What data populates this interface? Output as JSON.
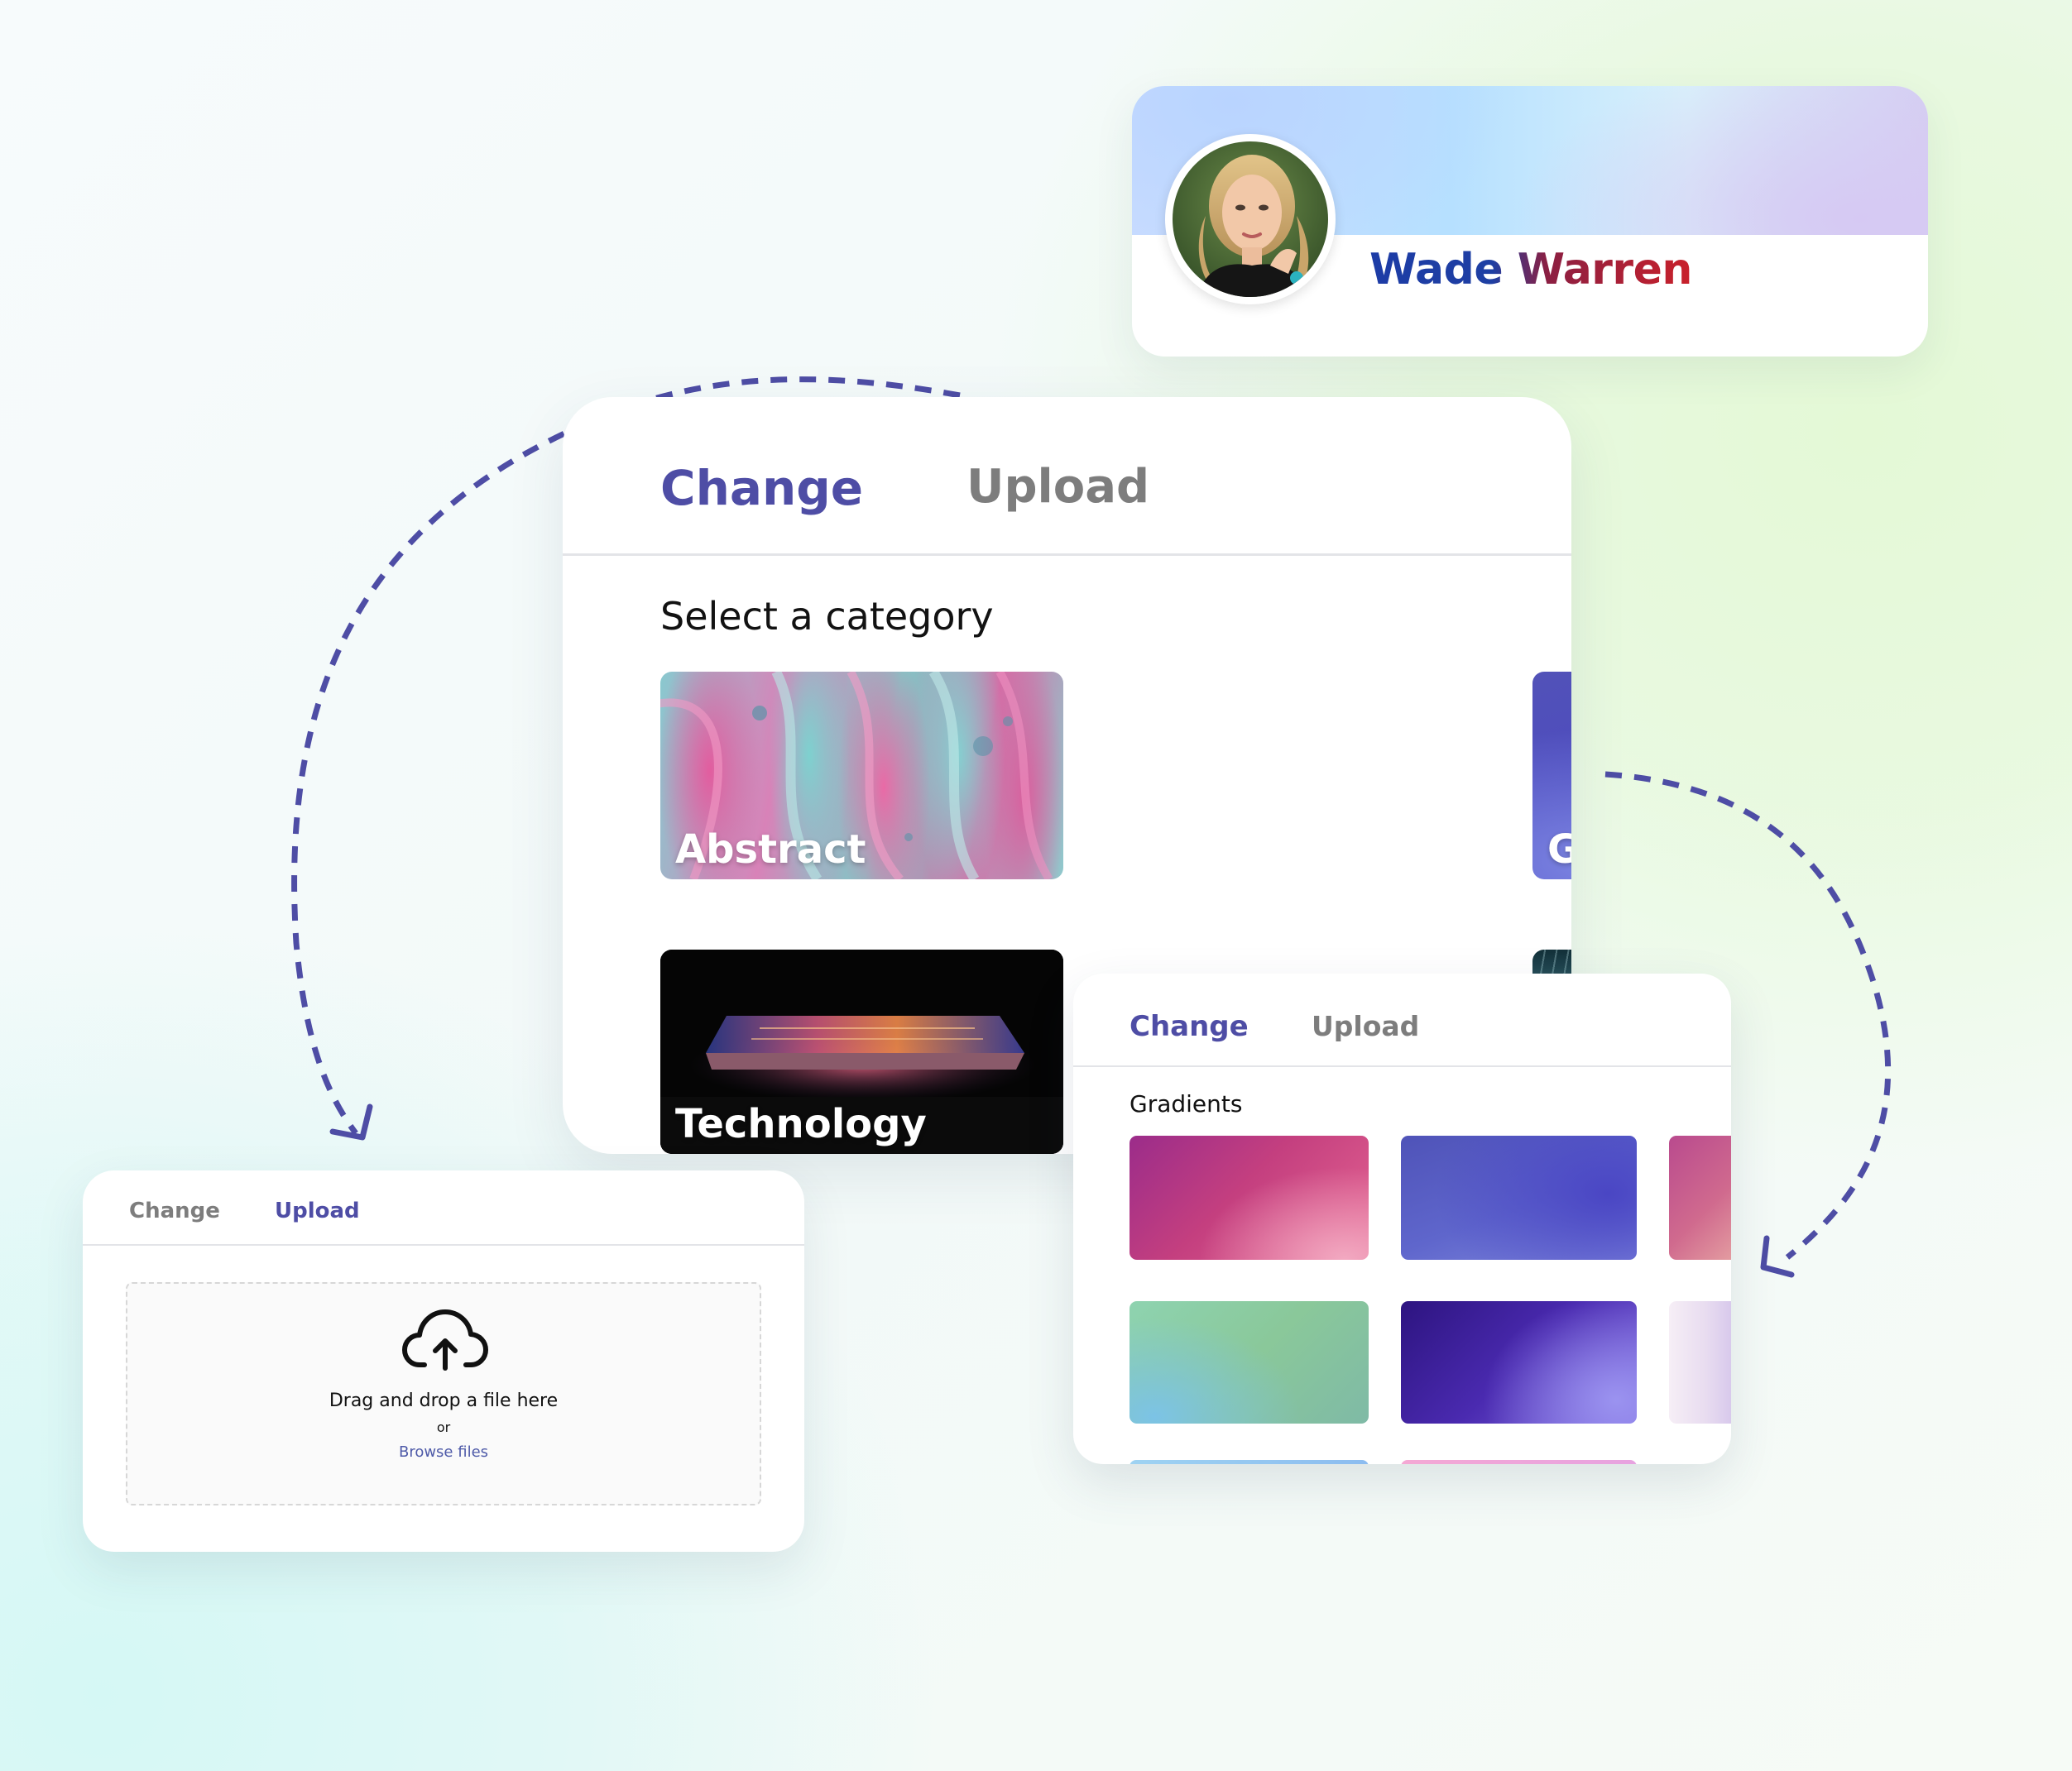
{
  "profile": {
    "name": "Wade Warren"
  },
  "main_panel": {
    "tabs": [
      {
        "label": "Change",
        "active": true
      },
      {
        "label": "Upload",
        "active": false
      }
    ],
    "section_title": "Select a category",
    "categories": [
      "Abstract",
      "Gradients",
      "Technology"
    ]
  },
  "gradients_panel": {
    "tabs": [
      {
        "label": "Change",
        "active": true
      },
      {
        "label": "Upload",
        "active": false
      }
    ],
    "section_title": "Gradients"
  },
  "upload_panel": {
    "tabs": [
      {
        "label": "Change",
        "active": false
      },
      {
        "label": "Upload",
        "active": true
      }
    ],
    "drop_text": "Drag and drop a file here",
    "or_text": "or",
    "browse_label": "Browse files"
  },
  "colors": {
    "accent": "#4e4da5",
    "inactive_tab": "#7d7d7d",
    "connector_dashes": "#4e4da5",
    "link": "#4e5aa8"
  },
  "icons": {
    "connector": "dashed-arrow-icon",
    "upload": "cloud-upload-icon"
  }
}
